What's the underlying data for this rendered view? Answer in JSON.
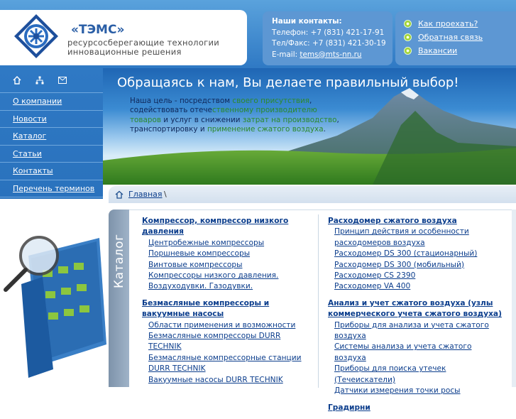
{
  "brand": {
    "name": "«ТЭМС»",
    "tagline_line1": "ресурсосберегающие технологии",
    "tagline_line2": "инновационные решения"
  },
  "contacts": {
    "title": "Наши контакты:",
    "phone": "Телефон: +7 (831) 421-17-91",
    "fax": "Тел/Факс: +7 (831) 421-30-19",
    "email_label": "E-mail: ",
    "email": "tems@mts-nn.ru"
  },
  "quick_links": [
    {
      "label": "Как проехать?"
    },
    {
      "label": "Обратная связь"
    },
    {
      "label": "Вакансии"
    }
  ],
  "nav_icons": [
    "home-icon",
    "sitemap-icon",
    "mail-icon"
  ],
  "nav": [
    {
      "label": "О компании"
    },
    {
      "label": "Новости"
    },
    {
      "label": "Каталог"
    },
    {
      "label": "Статьи"
    },
    {
      "label": "Контакты"
    },
    {
      "label": "Перечень терминов"
    }
  ],
  "hero": {
    "slogan": "Обращаясь к нам, Вы делаете правильный выбор!",
    "t1": "Наша цель - посредством ",
    "t2": "своего присутствия",
    "t3": ", содействовать отече",
    "t4": "ственному производителю товаров",
    "t5": " и услуг в снижении ",
    "t6": "затрат на производство",
    "t7": ", транспортировку и ",
    "t8": "применение сжатого воздуха",
    "t9": "."
  },
  "breadcrumb": {
    "home_label": "Главная",
    "separator": "\\"
  },
  "catalog": {
    "tab_label": "Каталог",
    "col1": [
      {
        "title": "Компрессор, компрессор низкого давления",
        "items": [
          "Центробежные компрессоры",
          "Поршневые компрессоры",
          "Винтовые компрессоры",
          "Компрессоры низкого давления.",
          "Воздуходувки. Газодувки."
        ]
      },
      {
        "title": "Безмасляные компрессоры и вакуумные насосы",
        "items": [
          "Области применения и возможности",
          "Безмасляные компрессоры DURR TECHNIK",
          "Безмасляные компрессорные станции DURR TECHNIK",
          "Вакуумные насосы DURR TECHNIK"
        ]
      }
    ],
    "col2": [
      {
        "title": "Расходомер сжатого воздуха",
        "items": [
          "Принцип действия и особенности расходомеров воздуха",
          "Расходомер DS 300 (стационарный)",
          "Расходомер DS 300 (мобильный)",
          "Расходомер CS 2390",
          "Расходомер VA 400"
        ]
      },
      {
        "title": "Анализ и учет сжатого воздуха (узлы коммерческого учета сжатого воздуха)",
        "items": [
          "Приборы для анализа и учета сжатого воздуха",
          "Системы анализа и учета сжатого воздуха",
          "Приборы для поиска утечек (Течеискатели)",
          "Датчики измерения точки росы"
        ]
      },
      {
        "title": "Градирни",
        "items": []
      }
    ]
  },
  "colors": {
    "header_blue": "#2f79c4",
    "link_blue": "#0b3d8c",
    "accent_green": "#2d8a2d"
  }
}
